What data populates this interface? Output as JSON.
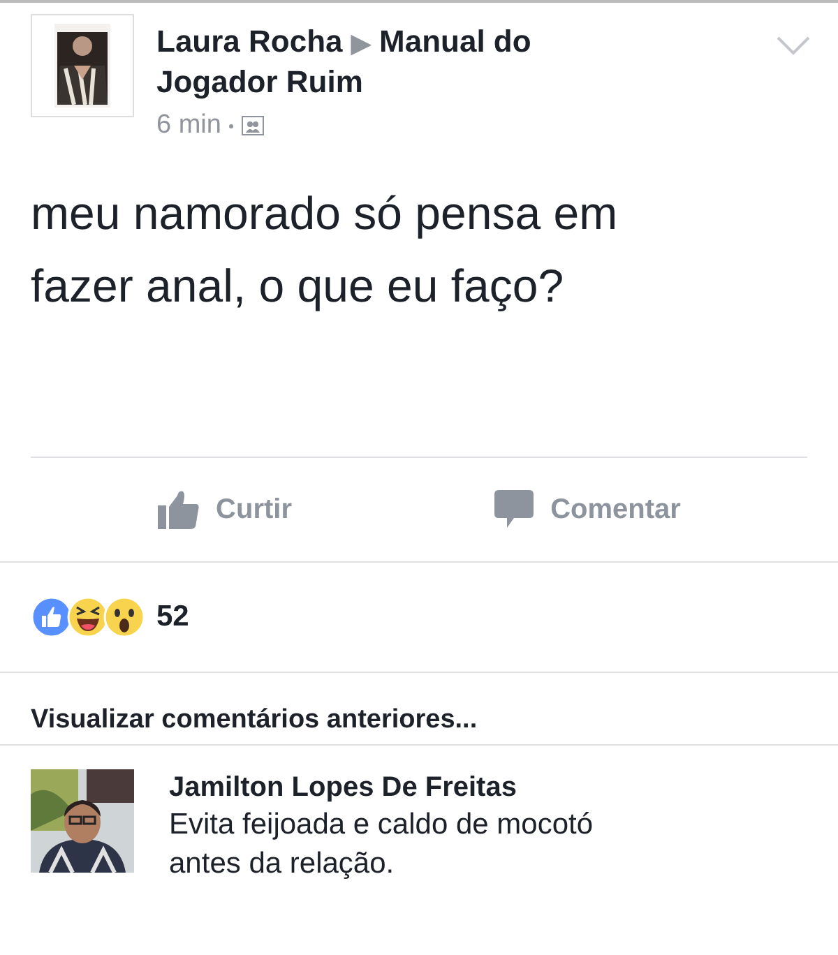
{
  "post": {
    "author": "Laura Rocha",
    "separator": "▶",
    "group": "Manual do Jogador Ruim",
    "time": "6 min",
    "text": "meu namorado só pensa em fazer anal, o que eu faço?"
  },
  "actions": [
    {
      "kind": "like",
      "label": "Curtir"
    },
    {
      "kind": "comment",
      "label": "Comentar"
    }
  ],
  "reactions": {
    "items": [
      {
        "kind": "like"
      },
      {
        "kind": "haha"
      },
      {
        "kind": "wow"
      }
    ],
    "count": "52"
  },
  "previous_comments": "Visualizar comentários anteriores...",
  "comments": [
    {
      "author": "Jamilton Lopes De Freitas",
      "text": "Evita feijoada e caldo de mocotó antes da relação."
    }
  ]
}
